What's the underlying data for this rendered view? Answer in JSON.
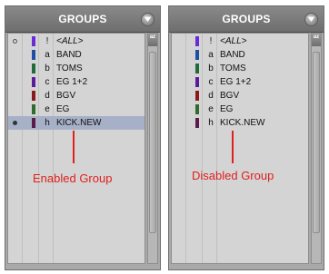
{
  "panels": [
    {
      "title": "GROUPS",
      "rows": [
        {
          "marker": "hollow",
          "color": "#6a2bd6",
          "letter": "!",
          "name": "<ALL>",
          "italic": true,
          "selected": false
        },
        {
          "marker": "",
          "color": "#1f4fa3",
          "letter": "a",
          "name": "BAND",
          "selected": false
        },
        {
          "marker": "",
          "color": "#1f6b3a",
          "letter": "b",
          "name": "TOMS",
          "selected": false
        },
        {
          "marker": "",
          "color": "#5b1c9c",
          "letter": "c",
          "name": "EG 1+2",
          "selected": false
        },
        {
          "marker": "",
          "color": "#8a1a1a",
          "letter": "d",
          "name": "BGV",
          "selected": false
        },
        {
          "marker": "",
          "color": "#2f6b2a",
          "letter": "e",
          "name": "EG",
          "selected": false
        },
        {
          "marker": "solid",
          "color": "#5a1a4a",
          "letter": "h",
          "name": "KICK.NEW",
          "selected": true
        }
      ],
      "annotation": "Enabled Group"
    },
    {
      "title": "GROUPS",
      "rows": [
        {
          "marker": "",
          "color": "#6a2bd6",
          "letter": "!",
          "name": "<ALL>",
          "italic": true,
          "selected": false
        },
        {
          "marker": "",
          "color": "#1f4fa3",
          "letter": "a",
          "name": "BAND",
          "selected": false
        },
        {
          "marker": "",
          "color": "#1f6b3a",
          "letter": "b",
          "name": "TOMS",
          "selected": false
        },
        {
          "marker": "",
          "color": "#5b1c9c",
          "letter": "c",
          "name": "EG 1+2",
          "selected": false
        },
        {
          "marker": "",
          "color": "#8a1a1a",
          "letter": "d",
          "name": "BGV",
          "selected": false
        },
        {
          "marker": "",
          "color": "#2f6b2a",
          "letter": "e",
          "name": "EG",
          "selected": false
        },
        {
          "marker": "",
          "color": "#5a1a4a",
          "letter": "h",
          "name": "KICK.NEW",
          "selected": false
        }
      ],
      "annotation": "Disabled Group"
    }
  ],
  "sort_icon_label": "az",
  "annotation_color": "#e02020"
}
